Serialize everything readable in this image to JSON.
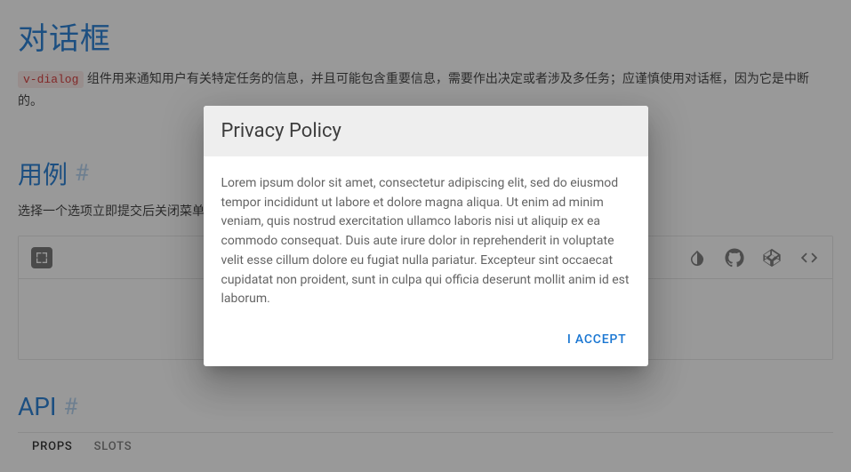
{
  "page": {
    "title": "对话框",
    "code_chip": "v-dialog",
    "description_after_code": " 组件用来通知用户有关特定任务的信息，并且可能包含重要信息，需要作出决定或者涉及多任务；应谨慎使用对话框，因为它是中断的。"
  },
  "usage": {
    "heading": "用例",
    "hash": "#",
    "description": "选择一个选项立即提交后关闭菜单。"
  },
  "api": {
    "heading": "API",
    "hash": "#",
    "tabs": [
      "PROPS",
      "SLOTS"
    ],
    "active_tab": 0
  },
  "dialog": {
    "title": "Privacy Policy",
    "body": "Lorem ipsum dolor sit amet, consectetur adipiscing elit, sed do eiusmod tempor incididunt ut labore et dolore magna aliqua. Ut enim ad minim veniam, quis nostrud exercitation ullamco laboris nisi ut aliquip ex ea commodo consequat. Duis aute irure dolor in reprehenderit in voluptate velit esse cillum dolore eu fugiat nulla pariatur. Excepteur sint occaecat cupidatat non proident, sunt in culpa qui officia deserunt mollit anim id est laborum.",
    "accept_label": "I Accept"
  }
}
